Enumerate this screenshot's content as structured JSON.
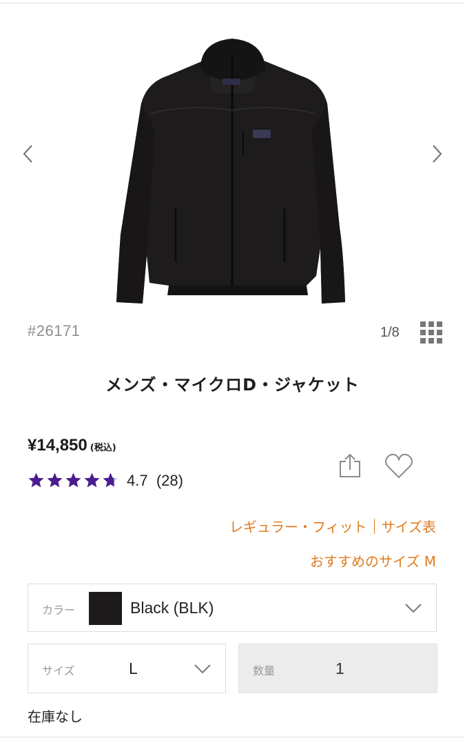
{
  "product": {
    "sku": "#26171",
    "pager": "1/8",
    "title": "メンズ・マイクロD・ジャケット",
    "price": "¥14,850",
    "tax_note": "(税込)",
    "rating_value": 4.7,
    "rating_text": "4.7",
    "review_count": "(28)",
    "star_color": "#4b1c8f"
  },
  "fit": {
    "fit_label": "レギュラー・フィット",
    "size_chart_link": "サイズ表",
    "recommended": "おすすめのサイズ M",
    "accent_color": "#e07b1f"
  },
  "options": {
    "color_label": "カラー",
    "color_value": "Black (BLK)",
    "swatch_color": "#1c1a1a",
    "size_label": "サイズ",
    "size_value": "L",
    "qty_label": "数量",
    "qty_value": "1"
  },
  "stock_status": "在庫なし",
  "icons": {
    "prev": "chevron-left-icon",
    "next": "chevron-right-icon",
    "grid": "grid-view-icon",
    "share": "share-icon",
    "favorite": "heart-icon",
    "star": "star-icon",
    "dropdown": "chevron-down-icon"
  }
}
